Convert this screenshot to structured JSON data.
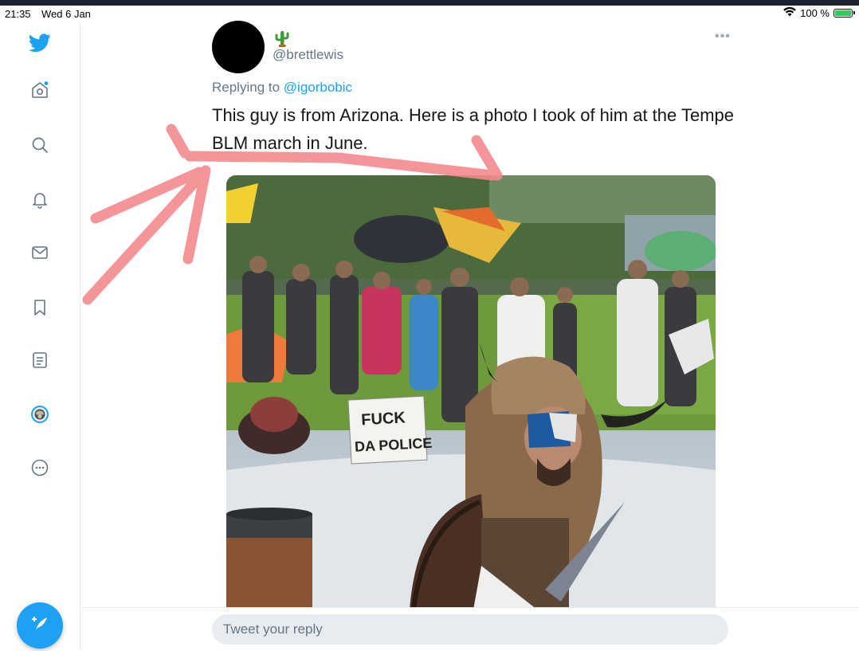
{
  "status_bar": {
    "time": "21:35",
    "date": "Wed 6 Jan",
    "battery": "100 %"
  },
  "sidebar": {
    "items": [
      {
        "name": "twitter-logo-icon"
      },
      {
        "name": "home-icon"
      },
      {
        "name": "explore-search-icon"
      },
      {
        "name": "notifications-bell-icon"
      },
      {
        "name": "messages-envelope-icon"
      },
      {
        "name": "bookmarks-icon"
      },
      {
        "name": "lists-icon"
      },
      {
        "name": "profile-avatar-icon"
      },
      {
        "name": "more-options-icon"
      }
    ],
    "compose_icon": "compose-tweet-icon"
  },
  "tweet": {
    "handle": "@brettlewis",
    "name_emoji": "cactus-icon",
    "replying_prefix": "Replying to",
    "replying_to": "@igorbobic",
    "text": "This guy is from Arizona. Here is a photo I took of him at the Tempe BLM march in June.",
    "more_icon": "more-dots-icon",
    "photo_sign_text": "FUCK DA POLICE"
  },
  "reply": {
    "placeholder": "Tweet your reply"
  },
  "colors": {
    "accent": "#1da1f2",
    "secondary_text": "#657786",
    "annotation": "#f28a8f"
  }
}
